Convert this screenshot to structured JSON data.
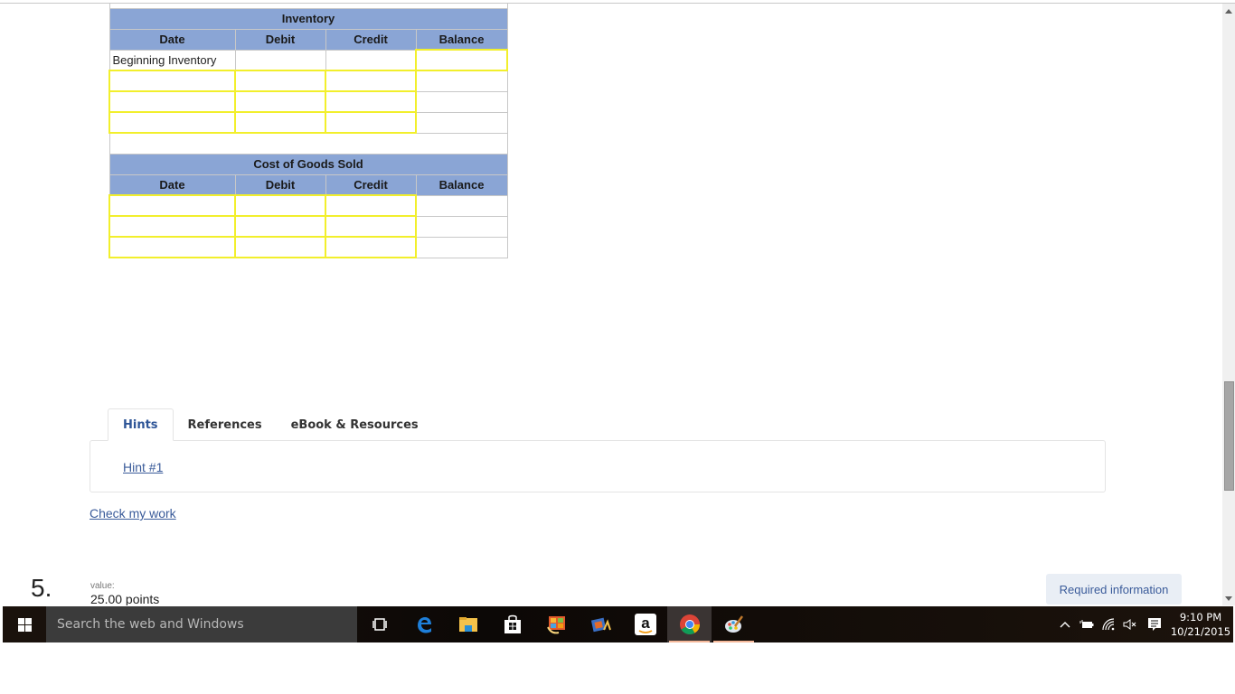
{
  "inventory_account": {
    "title": "Inventory",
    "columns": [
      "Date",
      "Debit",
      "Credit",
      "Balance"
    ],
    "rows": [
      {
        "date": "Beginning Inventory",
        "debit": "",
        "credit": "",
        "balance": ""
      },
      {
        "date": "",
        "debit": "",
        "credit": "",
        "balance": ""
      },
      {
        "date": "",
        "debit": "",
        "credit": "",
        "balance": ""
      },
      {
        "date": "",
        "debit": "",
        "credit": "",
        "balance": ""
      }
    ]
  },
  "cogs_account": {
    "title": "Cost of Goods Sold",
    "columns": [
      "Date",
      "Debit",
      "Credit",
      "Balance"
    ],
    "rows": [
      {
        "date": "",
        "debit": "",
        "credit": "",
        "balance": ""
      },
      {
        "date": "",
        "debit": "",
        "credit": "",
        "balance": ""
      },
      {
        "date": "",
        "debit": "",
        "credit": "",
        "balance": ""
      }
    ]
  },
  "tabs": [
    {
      "label": "Hints",
      "active": true
    },
    {
      "label": "References",
      "active": false
    },
    {
      "label": "eBook & Resources",
      "active": false
    }
  ],
  "hints": {
    "link": "Hint #1"
  },
  "check_my_work": "Check my work",
  "next_question": {
    "number": "5.",
    "value_label": "value:",
    "points": "25.00 points",
    "required_button": "Required information"
  },
  "taskbar": {
    "search_placeholder": "Search the web and Windows",
    "apps": [
      {
        "name": "task-view",
        "glyph": "[ ]"
      },
      {
        "name": "edge",
        "glyph": "e"
      },
      {
        "name": "file-explorer",
        "glyph": ""
      },
      {
        "name": "store",
        "glyph": ""
      },
      {
        "name": "photo-gallery",
        "glyph": ""
      },
      {
        "name": "movie-maker",
        "glyph": ""
      },
      {
        "name": "amazon",
        "glyph": "a"
      },
      {
        "name": "chrome",
        "glyph": ""
      },
      {
        "name": "paint",
        "glyph": ""
      }
    ],
    "time": "9:10 PM",
    "date": "10/21/2015"
  },
  "colors": {
    "header_bg": "#8aa5d5",
    "editable_border": "#f2ef2c",
    "link": "#3a5b9a"
  }
}
